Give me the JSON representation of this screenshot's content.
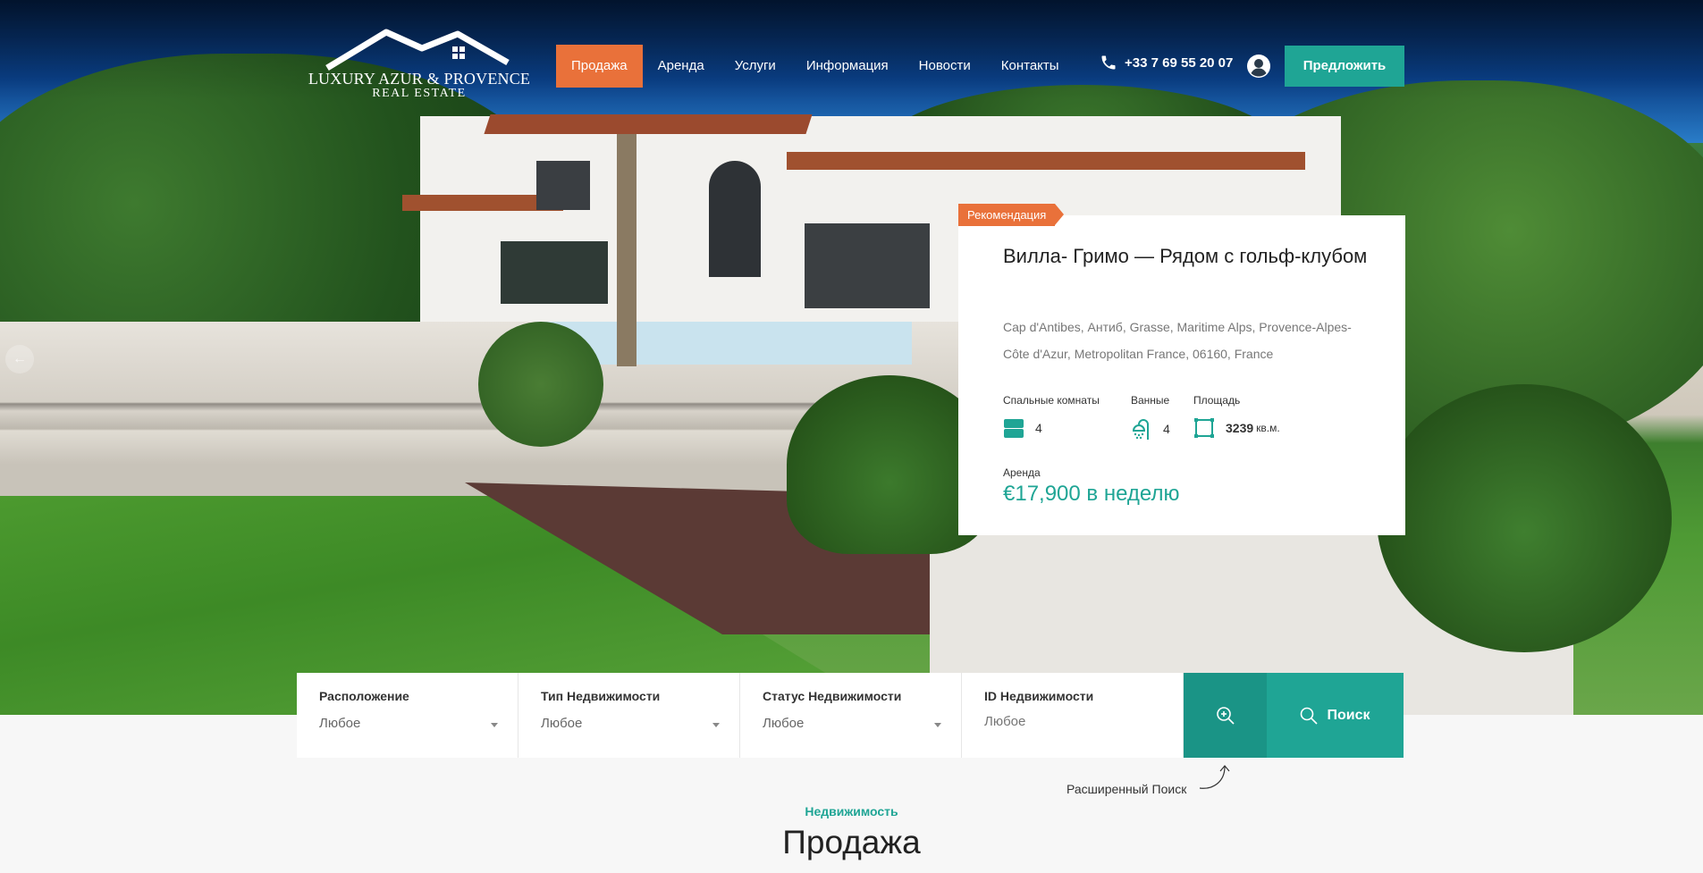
{
  "logo": {
    "line1": "LUXURY AZUR & PROVENCE",
    "line2": "REAL ESTATE"
  },
  "nav": {
    "items": [
      {
        "label": "Продажа",
        "active": true
      },
      {
        "label": "Аренда",
        "active": false
      },
      {
        "label": "Услуги",
        "active": false
      },
      {
        "label": "Информация",
        "active": false
      },
      {
        "label": "Новости",
        "active": false
      },
      {
        "label": "Контакты",
        "active": false
      }
    ],
    "phone": "+33 7 69 55 20 07",
    "offer_button": "Предложить"
  },
  "featured": {
    "badge": "Рекомендация",
    "title": "Вилла- Гримо — Рядом с гольф-клубом",
    "address": "Cap d'Antibes, Антиб, Grasse, Maritime Alps, Provence-Alpes-Côte d'Azur, Metropolitan France, 06160, France",
    "bedrooms_label": "Спальные комнаты",
    "bedrooms": "4",
    "bathrooms_label": "Ванные",
    "bathrooms": "4",
    "area_label": "Площадь",
    "area": "3239",
    "area_unit": "кв.м.",
    "price_label": "Аренда",
    "price": "€17,900 в неделю"
  },
  "search": {
    "location_label": "Расположение",
    "location_value": "Любое",
    "type_label": "Тип Недвижимости",
    "type_value": "Любое",
    "status_label": "Статус Недвижимости",
    "status_value": "Любое",
    "id_label": "ID Недвижимости",
    "id_placeholder": "Любое",
    "search_button": "Поиск",
    "advanced_hint": "Расширенный Поиск"
  },
  "section": {
    "eyebrow": "Недвижимость",
    "title": "Продажа"
  },
  "colors": {
    "accent": "#1fa595",
    "orange": "#e9713a"
  }
}
